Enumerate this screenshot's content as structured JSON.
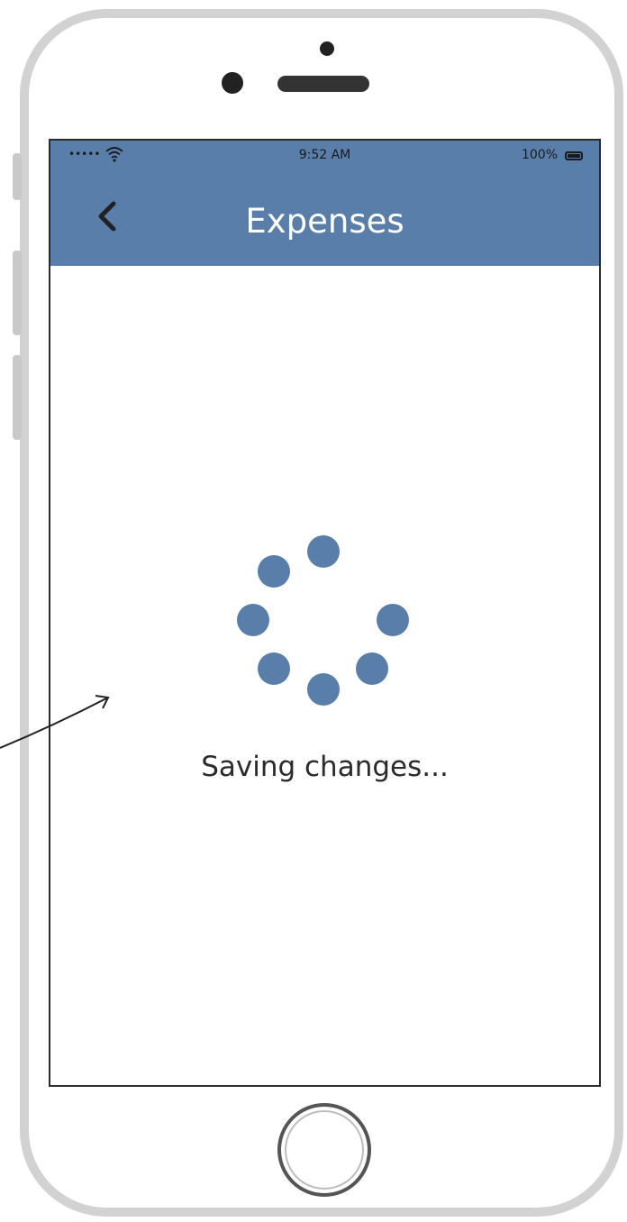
{
  "status_bar": {
    "signal": "•••••",
    "time": "9:52 AM",
    "battery": "100%"
  },
  "nav": {
    "title": "Expenses",
    "back_icon": "chevron-left-icon"
  },
  "loading": {
    "message": "Saving changes...",
    "spinner_icon": "loading-spinner-icon"
  },
  "colors": {
    "header": "#5a7eaa",
    "spinner": "#5a7eaa",
    "title_text": "#ffffff"
  }
}
